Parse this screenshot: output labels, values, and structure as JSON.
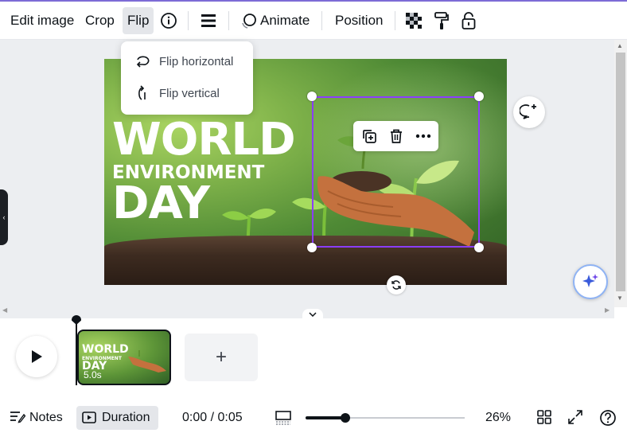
{
  "toolbar": {
    "edit_image": "Edit image",
    "crop": "Crop",
    "flip": "Flip",
    "animate": "Animate",
    "position": "Position"
  },
  "flip_menu": {
    "items": [
      {
        "label": "Flip horizontal",
        "icon": "flip-horizontal-icon"
      },
      {
        "label": "Flip vertical",
        "icon": "flip-vertical-icon"
      }
    ]
  },
  "design": {
    "title_line1": "WORLD",
    "title_line2": "ENVIRONMENT",
    "title_line3": "DAY"
  },
  "timeline": {
    "clip_duration": "5.0s",
    "add_page": "+"
  },
  "footer": {
    "notes": "Notes",
    "duration": "Duration",
    "time": "0:00 / 0:05",
    "zoom_fraction": 0.25,
    "zoom_label": "26%"
  },
  "colors": {
    "accent": "#8b3dff",
    "toolbar_active": "#e4e6ea",
    "text": "#0e1318"
  }
}
